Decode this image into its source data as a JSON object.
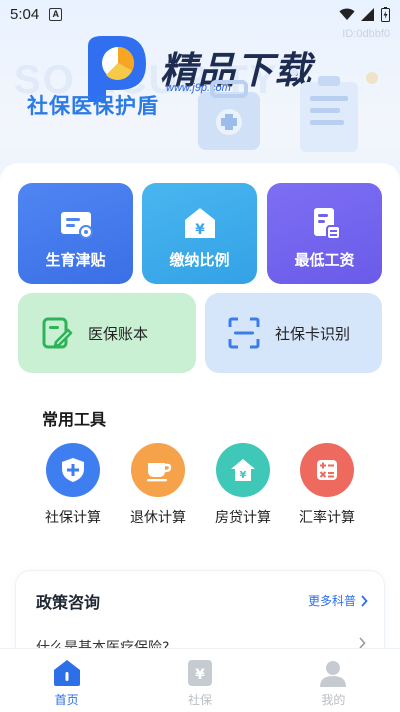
{
  "status_bar": {
    "time": "5:04",
    "notification_badge": "A"
  },
  "watermark": {
    "id_text": "ID:0dbbf0",
    "brand_title": "精品下载",
    "brand_url": "www.j9p.com",
    "bg_text": "SO     ECURITY"
  },
  "header": {
    "title": "社保医保护盾"
  },
  "tiles": [
    {
      "label": "生育津贴",
      "icon": "id-card-icon"
    },
    {
      "label": "缴纳比例",
      "icon": "yuan-house-icon"
    },
    {
      "label": "最低工资",
      "icon": "document-icon"
    }
  ],
  "wide_tiles": [
    {
      "label": "医保账本",
      "icon": "edit-note-icon"
    },
    {
      "label": "社保卡识别",
      "icon": "scan-icon"
    }
  ],
  "tools_section": {
    "title": "常用工具",
    "items": [
      {
        "label": "社保计算",
        "icon": "shield-plus-icon",
        "color": "#3f7ef0"
      },
      {
        "label": "退休计算",
        "icon": "cup-icon",
        "color": "#f5a24a"
      },
      {
        "label": "房贷计算",
        "icon": "house-yuan-icon",
        "color": "#3fc7b8"
      },
      {
        "label": "汇率计算",
        "icon": "calculator-icon",
        "color": "#ee6a5e"
      }
    ]
  },
  "policy": {
    "title": "政策咨询",
    "more_label": "更多科普",
    "first_question": "什么是基本医疗保险?"
  },
  "bottom_nav": [
    {
      "label": "首页",
      "active": true
    },
    {
      "label": "社保",
      "active": false
    },
    {
      "label": "我的",
      "active": false
    }
  ],
  "colors": {
    "accent": "#2c6fe6",
    "title_blue": "#2c7be5"
  }
}
